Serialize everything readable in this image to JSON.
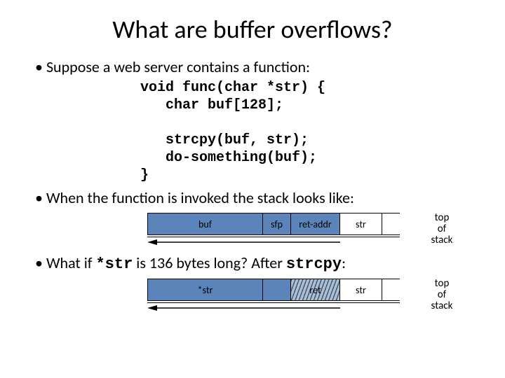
{
  "title": "What are buffer overflows?",
  "bullet1": "Suppose a web server contains a function:",
  "code": "void func(char *str) {\n   char buf[128];\n\n   strcpy(buf, str);\n   do-something(buf);\n}",
  "bullet2": "When the function is invoked the stack looks like:",
  "diagram1": {
    "buf": "buf",
    "sfp": "sfp",
    "ret": "ret-addr",
    "str": "str"
  },
  "tos": {
    "l1": "top",
    "l2": "of",
    "l3": "stack"
  },
  "bullet3": {
    "pre": "What if ",
    "code1": "*str",
    "mid": "  is  136 bytes long?   After  ",
    "code2": "strcpy",
    "post": ":"
  },
  "diagram2": {
    "str_label": "*str",
    "ret": "ret",
    "str": "str"
  }
}
